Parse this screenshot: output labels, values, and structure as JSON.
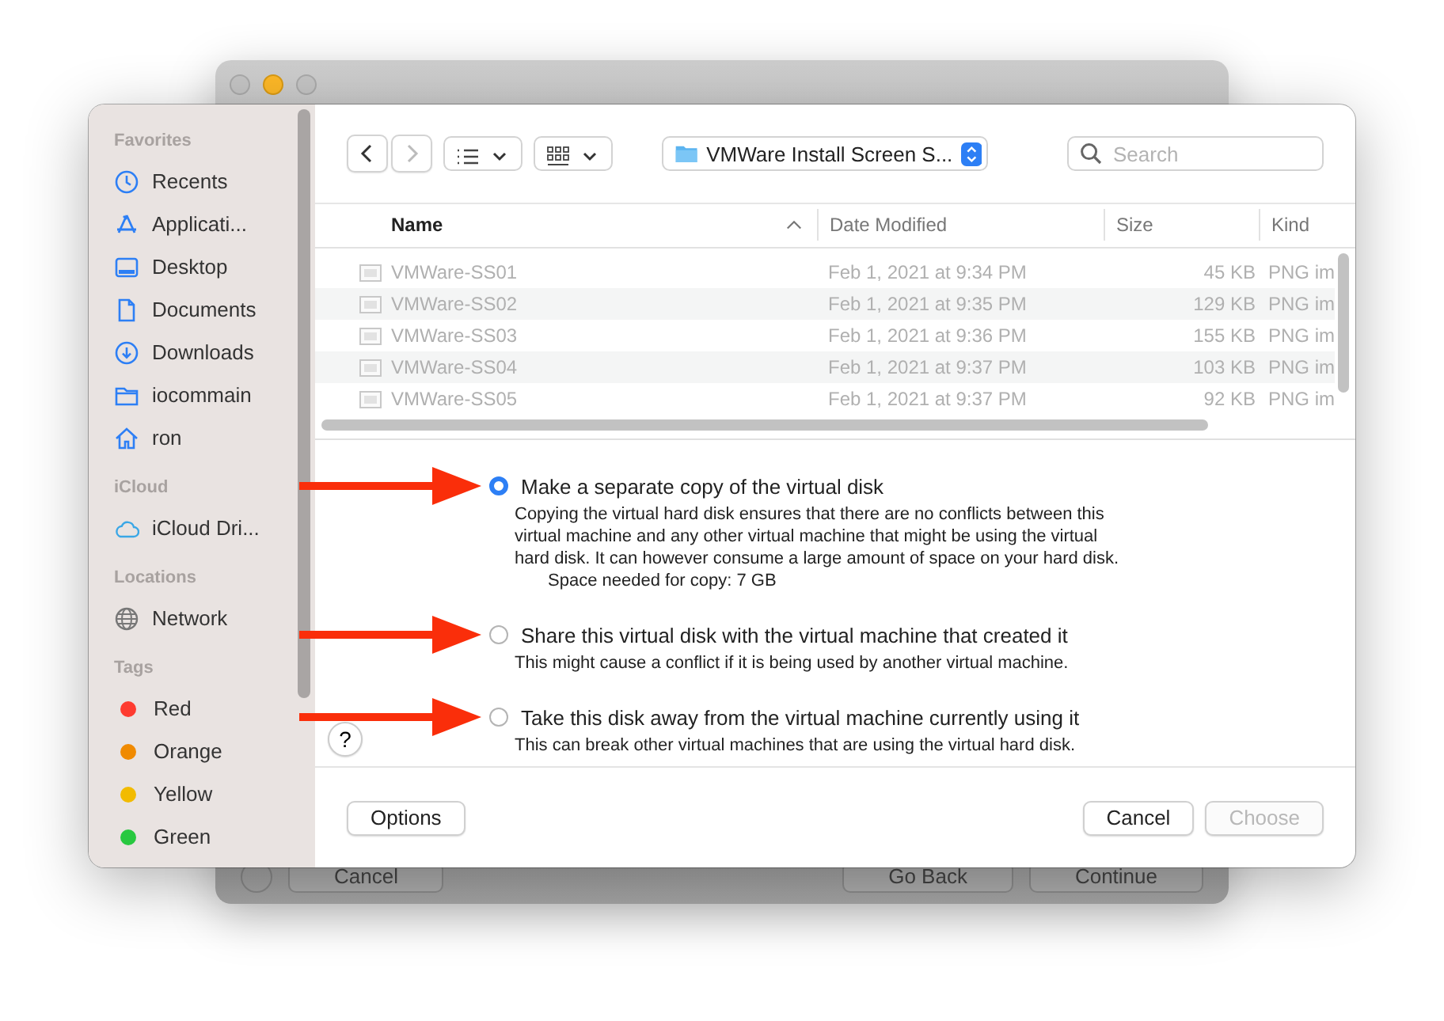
{
  "background_window": {
    "buttons": [
      {
        "label": "Cancel"
      },
      {
        "label": "Go Back"
      },
      {
        "label": "Continue"
      }
    ]
  },
  "sidebar": {
    "sections": [
      {
        "title": "Favorites",
        "items": [
          {
            "label": "Recents",
            "kind": "clock"
          },
          {
            "label": "Applicati...",
            "kind": "apps"
          },
          {
            "label": "Desktop",
            "kind": "desktop"
          },
          {
            "label": "Documents",
            "kind": "document"
          },
          {
            "label": "Downloads",
            "kind": "download"
          },
          {
            "label": "iocommain",
            "kind": "folder"
          },
          {
            "label": "ron",
            "kind": "home"
          }
        ]
      },
      {
        "title": "iCloud",
        "items": [
          {
            "label": "iCloud Dri...",
            "kind": "cloud"
          }
        ]
      },
      {
        "title": "Locations",
        "items": [
          {
            "label": "Network",
            "kind": "network"
          }
        ]
      },
      {
        "title": "Tags",
        "items": [
          {
            "label": "Red",
            "kind": "tag",
            "color": "#fe3b30"
          },
          {
            "label": "Orange",
            "kind": "tag",
            "color": "#f08a00"
          },
          {
            "label": "Yellow",
            "kind": "tag",
            "color": "#f2bb00"
          },
          {
            "label": "Green",
            "kind": "tag",
            "color": "#28c840"
          }
        ]
      }
    ]
  },
  "toolbar": {
    "location": "VMWare Install Screen S...",
    "search": {
      "placeholder": "Search"
    }
  },
  "file_list": {
    "columns": [
      {
        "label": "Name",
        "sorted": true
      },
      {
        "label": "Date Modified",
        "sorted": false
      },
      {
        "label": "Size",
        "sorted": false
      },
      {
        "label": "Kind",
        "sorted": false
      }
    ],
    "rows": [
      {
        "name": "VMWare-SS01",
        "date": "Feb 1, 2021 at 9:34 PM",
        "size": "45 KB",
        "kind": "PNG im",
        "disabled": true
      },
      {
        "name": "VMWare-SS02",
        "date": "Feb 1, 2021 at 9:35 PM",
        "size": "129 KB",
        "kind": "PNG im",
        "disabled": true
      },
      {
        "name": "VMWare-SS03",
        "date": "Feb 1, 2021 at 9:36 PM",
        "size": "155 KB",
        "kind": "PNG im",
        "disabled": true
      },
      {
        "name": "VMWare-SS04",
        "date": "Feb 1, 2021 at 9:37 PM",
        "size": "103 KB",
        "kind": "PNG im",
        "disabled": true
      },
      {
        "name": "VMWare-SS05",
        "date": "Feb 1, 2021 at 9:37 PM",
        "size": "92 KB",
        "kind": "PNG im",
        "disabled": true
      }
    ]
  },
  "options": [
    {
      "label": "Make a separate copy of the virtual disk",
      "selected": true,
      "description": "Copying the virtual hard disk ensures that there are no conflicts between this virtual machine and any other virtual machine that might be using the virtual hard disk.  It can however consume a large amount of space on your hard disk.",
      "detail": "Space needed for copy: 7 GB"
    },
    {
      "label": "Share this virtual disk with the virtual machine that created it",
      "selected": false,
      "description": "This might cause a conflict if it is being used by another virtual machine."
    },
    {
      "label": "Take this disk away from the virtual machine currently using it",
      "selected": false,
      "description": "This can break other virtual machines that are using the virtual hard disk."
    }
  ],
  "help_button": "?",
  "buttons": [
    {
      "label": "Options",
      "disabled": false
    },
    {
      "label": "Cancel",
      "disabled": false
    },
    {
      "label": "Choose",
      "disabled": true
    }
  ]
}
